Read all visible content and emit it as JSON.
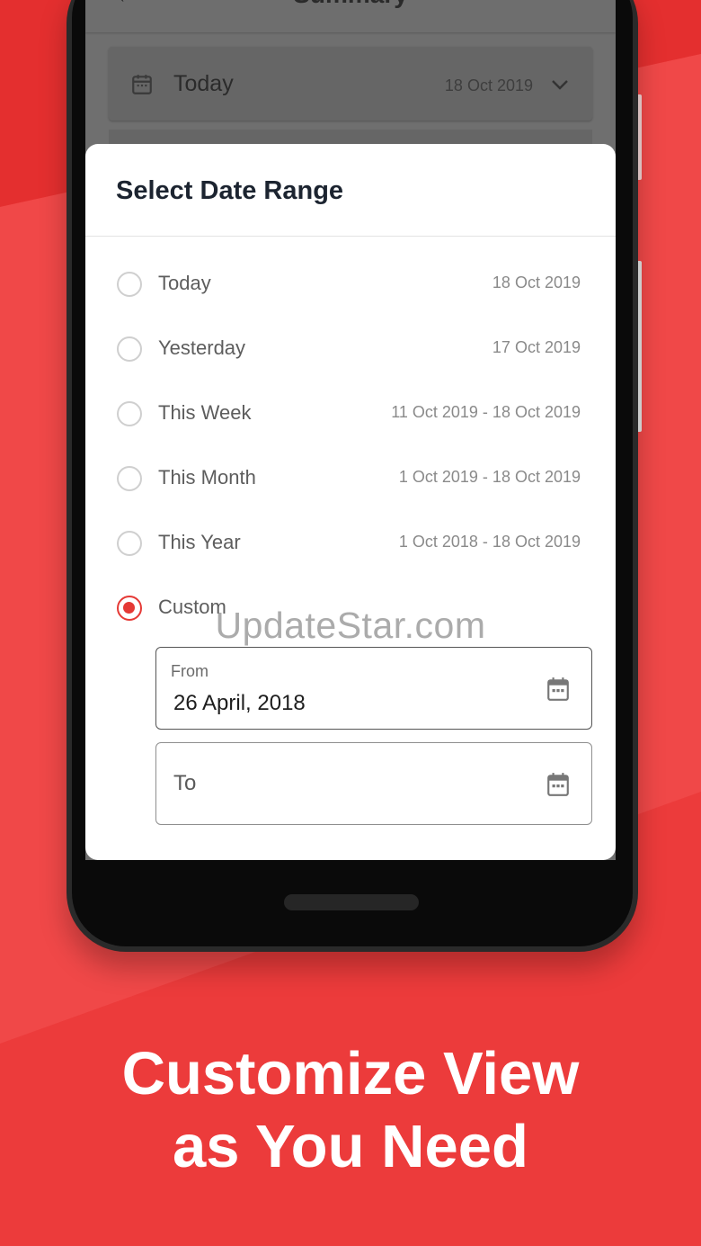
{
  "app": {
    "title": "Summary",
    "back_icon": "back-arrow-icon"
  },
  "summary_card": {
    "label": "Today",
    "date": "18 Oct 2019",
    "icon": "calendar-icon",
    "dropdown_icon": "chevron-down-icon"
  },
  "dialog": {
    "title": "Select Date Range",
    "options": [
      {
        "label": "Today",
        "range": "18 Oct 2019",
        "selected": false
      },
      {
        "label": "Yesterday",
        "range": "17 Oct 2019",
        "selected": false
      },
      {
        "label": "This Week",
        "range": "11 Oct 2019 - 18 Oct 2019",
        "selected": false
      },
      {
        "label": "This Month",
        "range": "1 Oct 2019 - 18 Oct 2019",
        "selected": false
      },
      {
        "label": "This Year",
        "range": "1 Oct 2018 - 18 Oct 2019",
        "selected": false
      },
      {
        "label": "Custom",
        "range": "",
        "selected": true
      }
    ],
    "from_field": {
      "label": "From",
      "value": "26 April, 2018"
    },
    "to_field": {
      "placeholder": "To",
      "value": ""
    }
  },
  "watermark": "UpdateStar.com",
  "headline": {
    "line1": "Customize View",
    "line2": "as You Need"
  },
  "colors": {
    "accent": "#e53935",
    "background_red": "#ec3b3b",
    "dialog_bg": "#ffffff"
  }
}
